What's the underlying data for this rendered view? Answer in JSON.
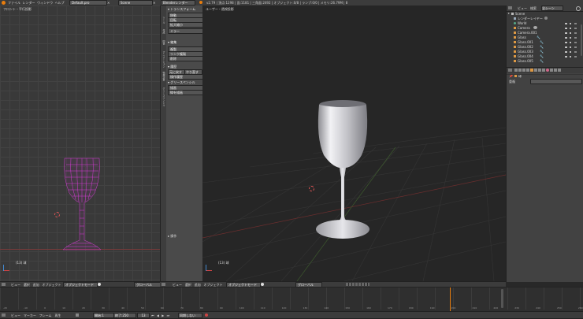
{
  "topbar": {
    "menus": [
      "ファイル",
      "レンダー",
      "ウィンドウ",
      "ヘルプ"
    ],
    "layout_name": "Default.pro",
    "scene_name": "Scene",
    "engine": "Blenderレンダー",
    "stats": "v2.79 | 頂点:1298 | 面:1181 | 三角面:2492 | オブジェクト:0/8 | ランプ:0/0 | メモリ:26.79M | 8"
  },
  "left_view": {
    "label": "フロント・平行投影",
    "object_label": "(13) 球"
  },
  "tool_shelf": {
    "sections": [
      {
        "label": "トランスフォーム",
        "items": [
          "移動",
          "回転",
          "拡大縮小",
          "ミラー"
        ]
      },
      {
        "label": "編集",
        "items": [
          "複製",
          "リンク複製",
          "削除"
        ]
      },
      {
        "label": "履歴",
        "items": [
          "元に戻す",
          "やり直す",
          "操作履歴"
        ]
      },
      {
        "label": "グリースペンシル",
        "items": [
          "描画",
          "線を描画"
        ]
      }
    ],
    "tabs": [
      "ツール",
      "作成",
      "関係",
      "アニメーション",
      "物理演算",
      "グリースペンシル"
    ],
    "operator_panel": "▸ 操作"
  },
  "right_view": {
    "label": "ユーザー・透視投影",
    "object_label": "(13) 球"
  },
  "view_header": {
    "view": "ビュー",
    "select": "選択",
    "add": "追加",
    "object": "オブジェクト",
    "mode": "オブジェクトモード",
    "global": "グローバル"
  },
  "timeline": {
    "menus": [
      "ビュー",
      "マーカー",
      "フレーム",
      "再生"
    ],
    "start_label": "開始:1",
    "end_label": "終了:250",
    "current_frame": "13",
    "sync": "同期しない",
    "ticks": [
      "-20",
      "-10",
      "0",
      "10",
      "20",
      "30",
      "40",
      "50",
      "60",
      "70",
      "80",
      "90",
      "100",
      "110",
      "120",
      "130",
      "140",
      "150",
      "160",
      "170",
      "180",
      "190",
      "200",
      "210",
      "220",
      "230",
      "240",
      "250",
      "260"
    ]
  },
  "outliner": {
    "header": {
      "view": "ビュー",
      "search": "検索",
      "display": "全シーン"
    },
    "rows": [
      {
        "name": "Scene",
        "indent": 0,
        "icon": "scene"
      },
      {
        "name": "レンダーレイヤー",
        "indent": 1,
        "icon": "layers"
      },
      {
        "name": "World",
        "indent": 1,
        "icon": "world"
      },
      {
        "name": "Camera",
        "indent": 1,
        "icon": "camera"
      },
      {
        "name": "Camera.001",
        "indent": 1,
        "icon": "camera"
      },
      {
        "name": "Glass",
        "indent": 1,
        "icon": "mesh"
      },
      {
        "name": "Glass.001",
        "indent": 1,
        "icon": "mesh"
      },
      {
        "name": "Glass.002",
        "indent": 1,
        "icon": "mesh"
      },
      {
        "name": "Glass.003",
        "indent": 1,
        "icon": "mesh"
      },
      {
        "name": "Glass.004",
        "indent": 1,
        "icon": "mesh"
      },
      {
        "name": "Glass.005",
        "indent": 1,
        "icon": "mesh"
      }
    ]
  },
  "properties": {
    "breadcrumb": "球",
    "field_label": "重複"
  },
  "colors": {
    "accent": "#e87d0d",
    "wire": "#d63bd6",
    "bg": "#393939",
    "header": "#3c3c3c"
  }
}
